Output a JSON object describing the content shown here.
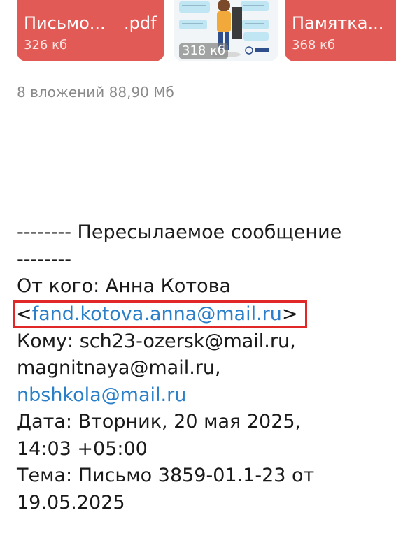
{
  "attachments": {
    "items": [
      {
        "name": "Письмо...",
        "ext": ".pdf",
        "size": "326 кб"
      },
      {
        "size": "318 кб"
      },
      {
        "name": "Памятка...",
        "size": "368 кб"
      }
    ],
    "summary": "8 вложений 88,90 Мб"
  },
  "message": {
    "forward_header_1": "-------- Пересылаемое сообщение",
    "forward_header_2": "--------",
    "from_label": "От кого: Анна Котова",
    "from_email": "fand.kotova.anna@mail.ru",
    "to_line_1": "Кому: sch23-ozersk@mail.ru,",
    "to_line_2": "magnitnaya@mail.ru,",
    "to_line_3": "nbshkola@mail.ru",
    "date_line_1": "Дата: Вторник, 20 мая 2025,",
    "date_line_2": "14:03 +05:00",
    "subject_line_1": "Тема: Письмо 3859-01.1-23 от",
    "subject_line_2": "19.05.2025"
  },
  "colors": {
    "card": "#e25a55",
    "link": "#2a7fc8",
    "highlight": "#e02828"
  }
}
